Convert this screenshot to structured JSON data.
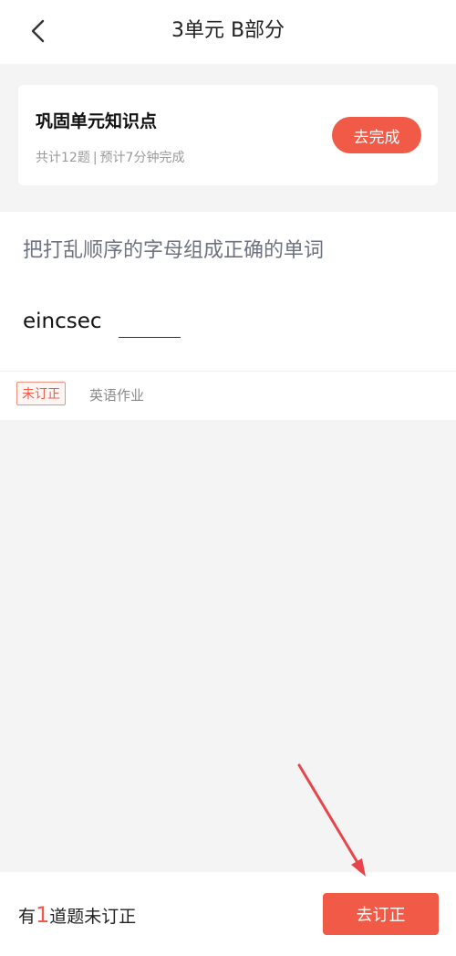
{
  "header": {
    "title": "3单元 B部分",
    "back_icon": "chevron-left-icon"
  },
  "task_card": {
    "title": "巩固单元知识点",
    "count_text": "共计12题",
    "separator": "|",
    "time_text": "预计7分钟完成",
    "complete_label": "去完成"
  },
  "question": {
    "prompt": "把打乱顺序的字母组成正确的单词",
    "scrambled_word": "eincsec",
    "status_tag": "未订正",
    "subject": "英语作业"
  },
  "bottom_bar": {
    "prefix": "有",
    "count": "1",
    "suffix": "道题未订正",
    "correct_label": "去订正"
  },
  "colors": {
    "accent": "#f05a47",
    "annotation_arrow": "#e8454a"
  }
}
